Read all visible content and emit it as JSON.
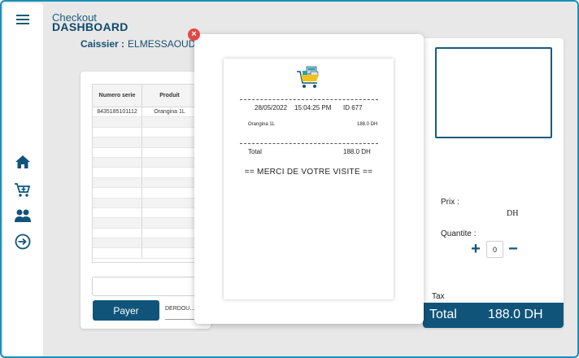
{
  "header": {
    "subtitle": "Checkout",
    "title": "DASHBOARD",
    "cashier_label": "Caissier :",
    "cashier_name": "ELMESSAOUDI"
  },
  "sidebar": {
    "items": [
      {
        "name": "menu",
        "icon": "hamburger-icon"
      },
      {
        "name": "home",
        "icon": "home-icon"
      },
      {
        "name": "cart",
        "icon": "cart-add-icon"
      },
      {
        "name": "users",
        "icon": "users-icon"
      },
      {
        "name": "logout",
        "icon": "logout-icon"
      }
    ]
  },
  "table": {
    "columns": [
      "Numero serie",
      "Produit"
    ],
    "rows": [
      [
        "8435185101112",
        "Orangina 1L"
      ],
      [
        "",
        ""
      ],
      [
        "",
        ""
      ],
      [
        "",
        ""
      ],
      [
        "",
        ""
      ],
      [
        "",
        ""
      ],
      [
        "",
        ""
      ],
      [
        "",
        ""
      ],
      [
        "",
        ""
      ],
      [
        "",
        ""
      ],
      [
        "",
        ""
      ],
      [
        "",
        ""
      ],
      [
        "",
        ""
      ],
      [
        "",
        ""
      ],
      [
        "",
        ""
      ]
    ]
  },
  "pay_button": "Payer",
  "client_select": "DERDOU...",
  "panel": {
    "prix_label": "Prix :",
    "currency": "DH",
    "quantite_label": "Quantite :",
    "quantity_value": "0",
    "plus": "+",
    "minus": "−",
    "tax_label": "Tax",
    "total_label": "Total",
    "total_value": "188.0 DH"
  },
  "receipt": {
    "date": "28/05/2022",
    "time": "15:04:25 PM",
    "id": "ID 677",
    "item_name": "Orangina 1L",
    "item_price": "188.0 DH",
    "total_label": "Total",
    "total_value": "188.0 DH",
    "thanks": "== MERCI DE VOTRE VISITE =="
  },
  "colors": {
    "primary": "#10547a",
    "accent_border": "#1b8fb8",
    "close": "#e04848",
    "logo_yellow": "#f2c21b",
    "logo_teal": "#2a9fb0"
  },
  "modal": {
    "close": "×"
  }
}
